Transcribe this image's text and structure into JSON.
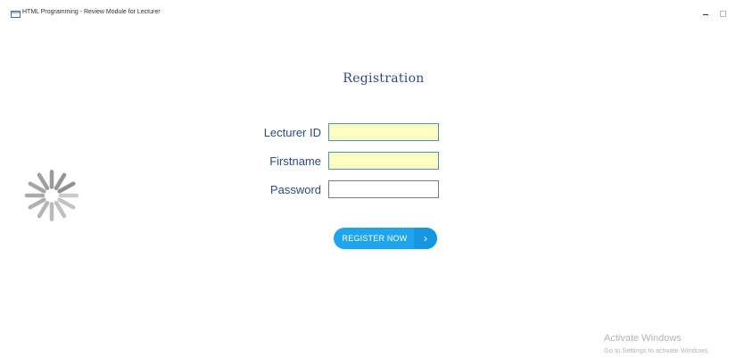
{
  "window": {
    "title": "HTML Programming - Review Module for Lecturer",
    "minimize_icon": "minimize-icon",
    "maximize_icon": "maximize-icon"
  },
  "page": {
    "title": "Registration"
  },
  "form": {
    "fields": [
      {
        "label": "Lecturer ID",
        "value": "",
        "type": "text"
      },
      {
        "label": "Firstname",
        "value": "",
        "type": "text"
      },
      {
        "label": "Password",
        "value": "",
        "type": "password"
      }
    ],
    "register_label": "REGISTER NOW",
    "register_arrow": "›"
  },
  "spinner": {
    "icon": "loading-spinner-icon",
    "color": "#8a8a8a"
  },
  "watermark": {
    "title": "Activate Windows",
    "subtitle": "Go to Settings to activate Windows."
  },
  "colors": {
    "accent": "#1fa5ee",
    "heading": "#2f4c7e",
    "input_fill": "#ffffc0"
  }
}
